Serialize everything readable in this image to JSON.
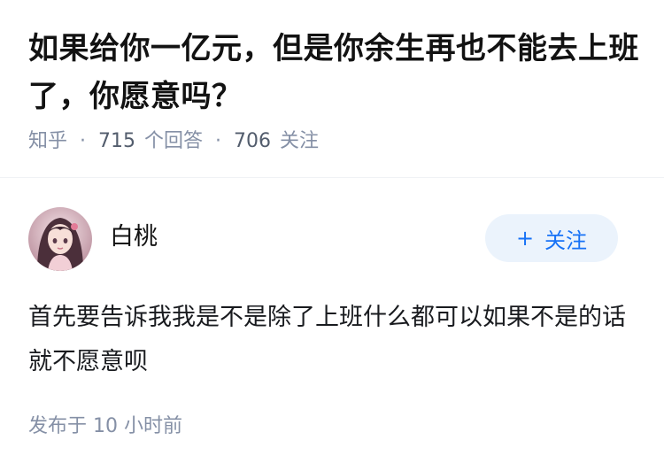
{
  "question": {
    "title": "如果给你一亿元，但是你余生再也不能去上班了，你愿意吗？",
    "source": "知乎",
    "answer_count": "715",
    "answer_label": "个回答",
    "follower_count": "706",
    "follower_label": "关注"
  },
  "answer": {
    "author_name": "白桃",
    "follow_label": "关注",
    "follow_icon": "plus-icon",
    "content": "首先要告诉我我是不是除了上班什么都可以如果不是的话就不愿意呗",
    "time_label": "发布于  10 小时前"
  },
  "colors": {
    "accent": "#1772f6",
    "follow_bg": "#ebf3fc",
    "meta_text": "#8590a6"
  }
}
